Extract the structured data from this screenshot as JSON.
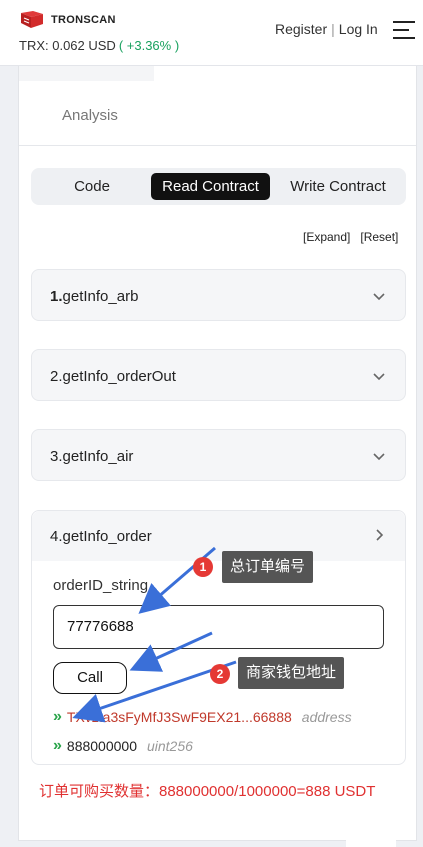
{
  "header": {
    "brand": "TRONSCAN",
    "price_label": "TRX: 0.062 USD",
    "price_change": "( +3.36% )",
    "register": "Register",
    "separator": "|",
    "login": "Log In"
  },
  "tabs": {
    "analysis": "Analysis"
  },
  "segments": [
    {
      "label": "Code",
      "active": false
    },
    {
      "label": "Read Contract",
      "active": true
    },
    {
      "label": "Write Contract",
      "active": false
    }
  ],
  "controls": {
    "expand": "[Expand]",
    "reset": "[Reset]"
  },
  "functions": [
    {
      "num": "1.",
      "name": "getInfo_arb"
    },
    {
      "num": "2.",
      "name": "getInfo_orderOut"
    },
    {
      "num": "3.",
      "name": "getInfo_air"
    },
    {
      "num": "4.",
      "name": "getInfo_order"
    }
  ],
  "open_function": {
    "param_label": "orderID_string",
    "param_value": "77776688",
    "call_label": "Call",
    "results": [
      {
        "arrow": "»",
        "value": "TXvzta3sFyMfJ3SwF9EX21...66888",
        "type": "address"
      },
      {
        "arrow": "»",
        "value": "888000000",
        "type": "uint256"
      }
    ]
  },
  "annotations": {
    "badge1": "1",
    "tip1": "总订单编号",
    "badge2": "2",
    "tip2": "商家钱包地址"
  },
  "note": "订单可购买数量：888000000/1000000=888 USDT",
  "colors": {
    "accent_red": "#e53935",
    "positive_green": "#19a15f",
    "address_red": "#c0392b",
    "arrow_blue": "#3a6fd8"
  }
}
